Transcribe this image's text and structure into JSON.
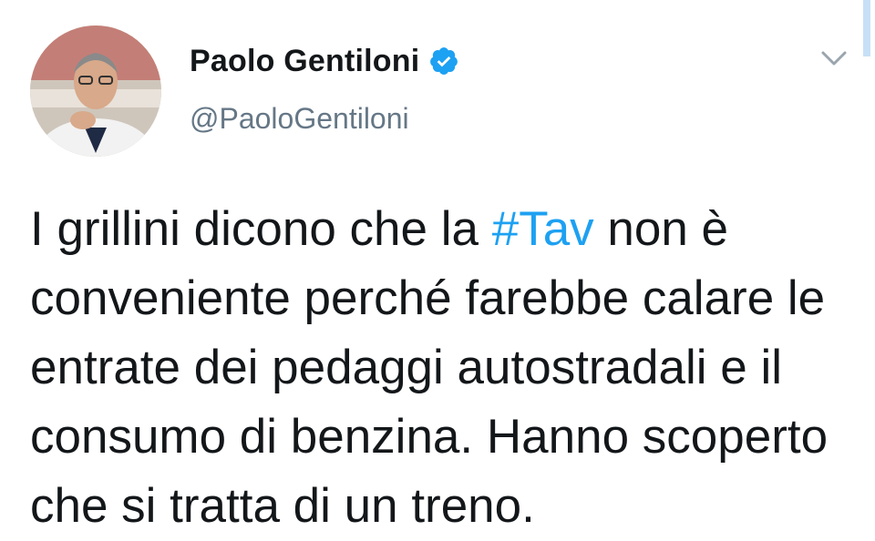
{
  "author": {
    "display_name": "Paolo Gentiloni",
    "handle": "@PaoloGentiloni",
    "verified": true,
    "avatar_icon": "profile-photo"
  },
  "tweet": {
    "text_before": "I grillini dicono che la ",
    "hashtag": "#Tav",
    "text_after": " non è conveniente perché farebbe calare le entrate dei pedaggi autostradali e il consumo di benzina. Hanno scoperto che si tratta di un treno."
  },
  "controls": {
    "menu_icon": "chevron-down-icon"
  },
  "colors": {
    "hashtag": "#1da1f2",
    "verified_badge": "#1da1f2",
    "handle": "#657786",
    "text": "#14171a"
  }
}
